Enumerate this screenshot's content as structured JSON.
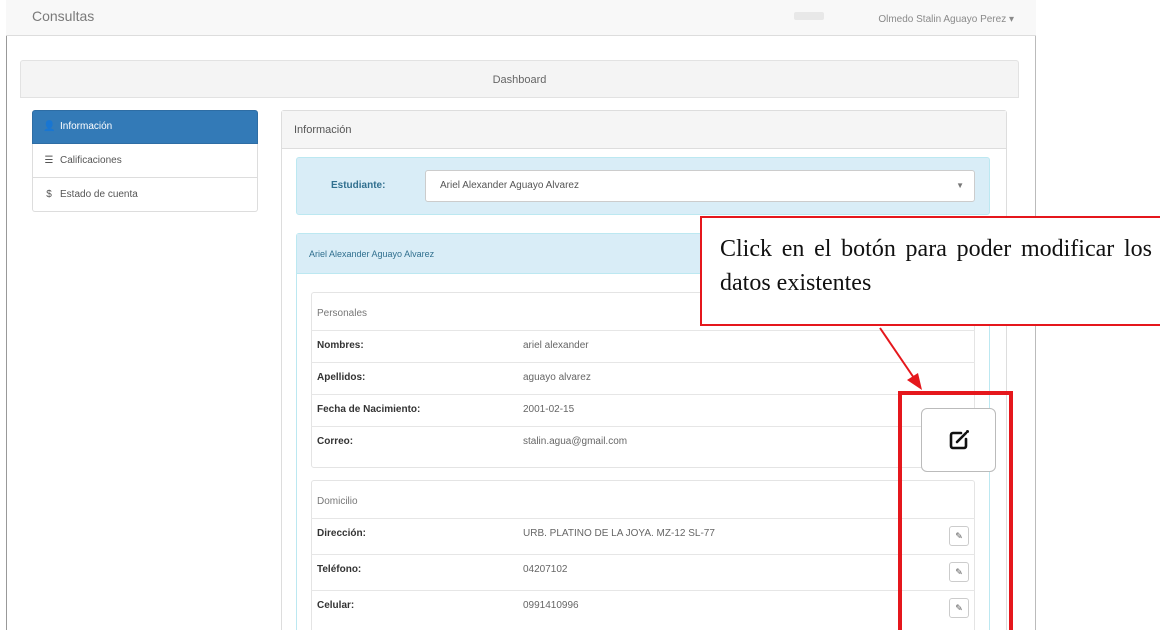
{
  "app": {
    "brand": "Consultas",
    "user_menu": "Olmedo Stalin Aguayo Perez ▾"
  },
  "dashboard": {
    "title": "Dashboard"
  },
  "sidebar": {
    "items": [
      {
        "label": "Información",
        "icon": "user-icon",
        "glyph": "👤",
        "active": true
      },
      {
        "label": "Calificaciones",
        "icon": "list-icon",
        "glyph": "☰",
        "active": false
      },
      {
        "label": "Estado de cuenta",
        "icon": "dollar-icon",
        "glyph": "$",
        "active": false
      }
    ]
  },
  "panel": {
    "title": "Información",
    "student_label": "Estudiante:",
    "student_selected": "Ariel Alexander Aguayo Alvarez",
    "student_panel_title": "Ariel Alexander Aguayo Alvarez"
  },
  "personales": {
    "title": "Personales",
    "rows": [
      {
        "label": "Nombres:",
        "value": "ariel alexander"
      },
      {
        "label": "Apellidos:",
        "value": "aguayo alvarez"
      },
      {
        "label": "Fecha de Nacimiento:",
        "value": "2001-02-15"
      },
      {
        "label": "Correo:",
        "value": "stalin.agua@gmail.com"
      }
    ]
  },
  "domicilio": {
    "title": "Domicilio",
    "rows": [
      {
        "label": "Dirección:",
        "value": "URB. PLATINO DE LA JOYA. MZ-12 SL-77"
      },
      {
        "label": "Teléfono:",
        "value": "04207102"
      },
      {
        "label": "Celular:",
        "value": "0991410996"
      }
    ]
  },
  "annotation": {
    "callout_text": "Click en el botón para poder modificar los datos existentes",
    "accent_color": "#e5171c"
  }
}
